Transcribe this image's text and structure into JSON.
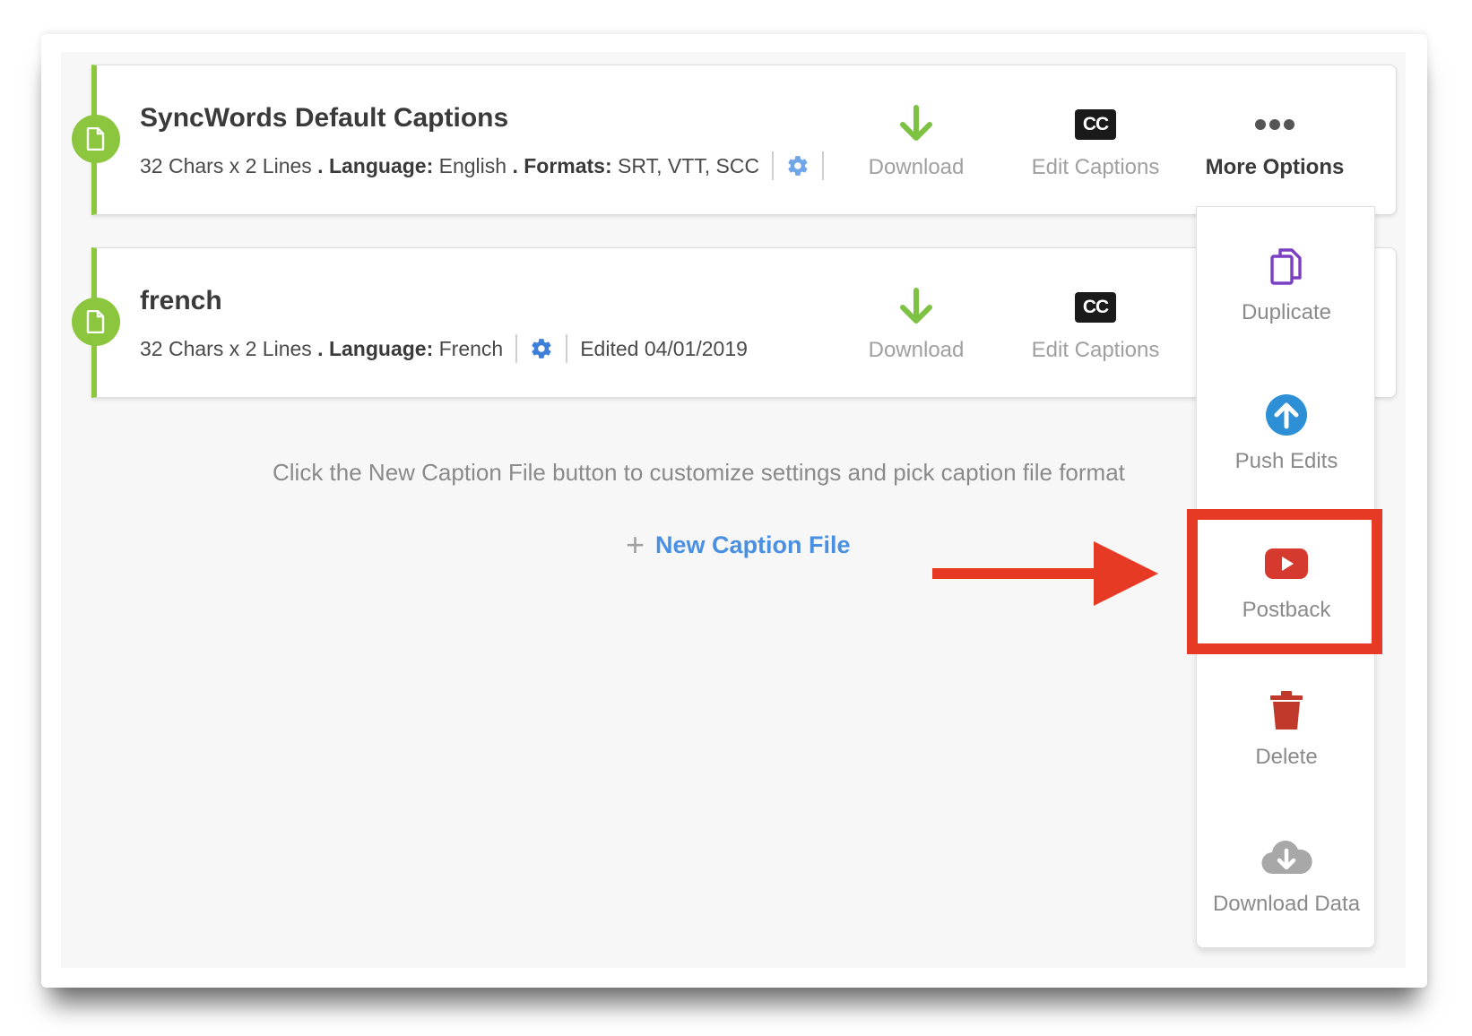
{
  "captions": [
    {
      "title": "SyncWords Default Captions",
      "chars": "32 Chars x 2 Lines",
      "dot1": " . ",
      "language_label": "Language:",
      "language": "English",
      "dot2": " . ",
      "formats_label": "Formats:",
      "formats": "SRT, VTT, SCC"
    },
    {
      "title": "french",
      "chars": "32 Chars x 2 Lines",
      "dot1": " . ",
      "language_label": "Language:",
      "language": "French",
      "edited": "Edited 04/01/2019"
    }
  ],
  "actions": {
    "download": "Download",
    "edit_captions": "Edit Captions",
    "cc_glyph": "CC",
    "more_options": "More Options"
  },
  "hint": "Click the New Caption File button to customize settings and pick caption file format",
  "new_caption": {
    "plus": "+",
    "label": "New Caption File"
  },
  "menu": {
    "duplicate": "Duplicate",
    "push_edits": "Push Edits",
    "postback": "Postback",
    "delete": "Delete",
    "download_data": "Download Data"
  },
  "colors": {
    "accent_green": "#8cc63f",
    "link_blue": "#4a90e2",
    "highlight_red": "#e63a24",
    "duplicate_purple": "#7b3fc4",
    "push_blue": "#2d8fd5",
    "delete_red": "#c0392b",
    "postback_red": "#d63a2f"
  }
}
